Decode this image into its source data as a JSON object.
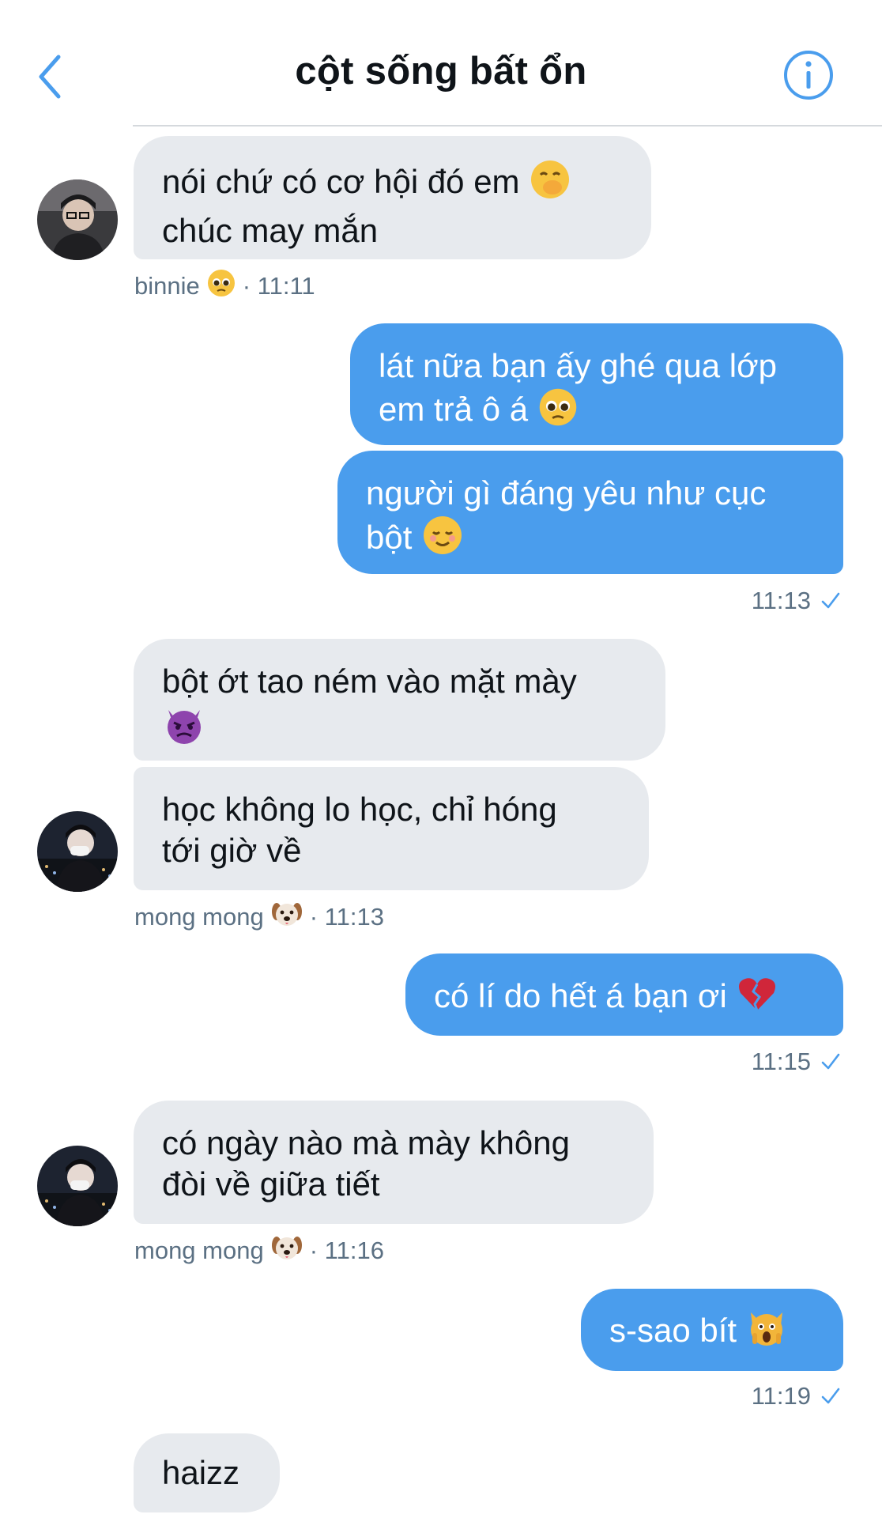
{
  "header": {
    "title": "cột sống bất ổn",
    "back_icon": "chevron-left-icon",
    "info_icon": "info-icon",
    "accent": "#4a9ded"
  },
  "colors": {
    "incoming_bubble": "#e7eaee",
    "outgoing_bubble": "#4a9ded",
    "meta_text": "#5b7083"
  },
  "messages": [
    {
      "dir": "in",
      "text": "nói chứ có cơ hội đó em",
      "emoji": "face-with-hand-over-mouth",
      "text2": "chúc may mắn"
    },
    {
      "dir": "in-meta",
      "sender": "binnie",
      "sender_emoji": "pleading-face",
      "time": "· 11:11"
    },
    {
      "dir": "out",
      "text": "lát nữa bạn ấy ghé qua lớp",
      "text2": "em trả ô á",
      "emoji": "pleading-face"
    },
    {
      "dir": "out",
      "text": "người gì đáng yêu như cục",
      "text2": "bột",
      "emoji": "smiling-face"
    },
    {
      "dir": "out-meta",
      "time": "11:13",
      "status_icon": "check-icon"
    },
    {
      "dir": "in",
      "text": "bột ớt tao ném vào mặt mày",
      "emoji": "angry-devil"
    },
    {
      "dir": "in",
      "text": "học không lo học, chỉ hóng",
      "text2": "tới giờ về"
    },
    {
      "dir": "in-meta",
      "sender": "mong mong",
      "sender_emoji": "dog-face",
      "time": "· 11:13"
    },
    {
      "dir": "out",
      "text": "có lí do hết á bạn ơi",
      "emoji": "broken-heart"
    },
    {
      "dir": "out-meta",
      "time": "11:15",
      "status_icon": "check-icon"
    },
    {
      "dir": "in",
      "text": "có ngày nào mà mày không",
      "text2": "đòi về giữa tiết"
    },
    {
      "dir": "in-meta",
      "sender": "mong mong",
      "sender_emoji": "dog-face",
      "time": "· 11:16"
    },
    {
      "dir": "out",
      "text": "s-sao bít",
      "emoji": "screaming-cat"
    },
    {
      "dir": "out-meta",
      "time": "11:19",
      "status_icon": "check-icon"
    },
    {
      "dir": "in",
      "text": "haizz"
    }
  ]
}
